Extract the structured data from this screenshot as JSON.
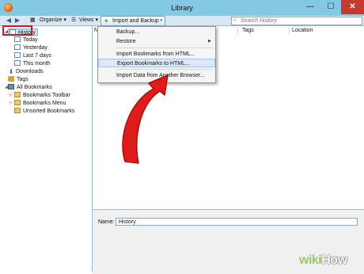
{
  "window": {
    "title": "Library",
    "controls": {
      "minimize": "—",
      "maximize": "☐",
      "close": "✕"
    }
  },
  "toolbar": {
    "back": "◀",
    "forward": "▶",
    "organize": "Organize ▾",
    "views": "Views ▾",
    "import_backup": "Import and Backup",
    "dropdown_arrow": "▾",
    "search_placeholder": "Search History"
  },
  "sidebar": {
    "history": "History",
    "periods": [
      "Today",
      "Yesterday",
      "Last 7 days",
      "This month"
    ],
    "downloads": "Downloads",
    "tags": "Tags",
    "all_bookmarks": "All Bookmarks",
    "bookmarks_toolbar": "Bookmarks Toolbar",
    "bookmarks_menu": "Bookmarks Menu",
    "unsorted_bookmarks": "Unsorted Bookmarks"
  },
  "columns": {
    "name_partial": "Na",
    "tags": "Tags",
    "location": "Location"
  },
  "menu": {
    "backup": "Backup...",
    "restore": "Restore",
    "import_html": "Import Bookmarks from HTML...",
    "export_html": "Export Bookmarks to HTML...",
    "import_browser": "Import Data from Another Browser..."
  },
  "details": {
    "name_label": "Name:",
    "name_value": "History"
  },
  "watermark": {
    "wiki": "wiki",
    "how": "How"
  },
  "icons": {
    "search": "search-icon",
    "back": "back-arrow-icon",
    "forward": "forward-arrow-icon",
    "import": "import-backup-icon"
  },
  "colors": {
    "titlebar": "#84c9e4",
    "close": "#c7382d",
    "highlight_box": "#e0121a",
    "arrow": "#e11a1a",
    "watermark_wiki": "#9bc86a"
  }
}
